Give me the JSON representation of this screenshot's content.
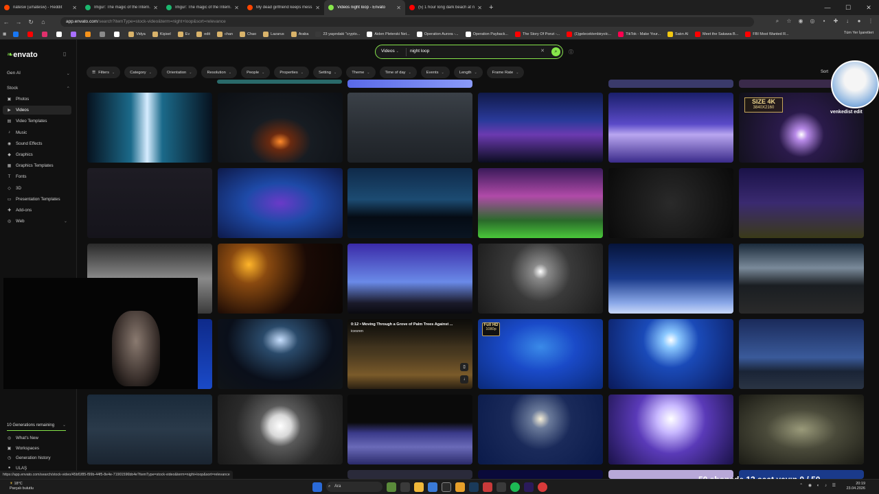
{
  "browser": {
    "tabs": [
      {
        "title": "natesw (u/natesw) - Reddit",
        "color": "#ff4500",
        "active": false
      },
      {
        "title": "Imgur: The magic of the Intern...",
        "color": "#1bb76e",
        "active": false
      },
      {
        "title": "Imgur: The magic of the Intern...",
        "color": "#1bb76e",
        "active": false
      },
      {
        "title": "My dead girlfriend keeps mess...",
        "color": "#ff4500",
        "active": false
      },
      {
        "title": "Videos night loop - Envato",
        "color": "#87e64b",
        "active": true
      },
      {
        "title": "(5) 1 hour long dark beach at n...",
        "color": "#ff0000",
        "active": false
      }
    ],
    "url_host": "app.envato.com",
    "url_path": "/search?itemType=stock-video&term=night+loop&sort=relevance",
    "bookmarks": [
      {
        "label": "",
        "color": "#1877f2"
      },
      {
        "label": "",
        "color": "#ff0000"
      },
      {
        "label": "",
        "color": "#e1306c"
      },
      {
        "label": "",
        "color": "#ffffff"
      },
      {
        "label": "",
        "color": "#a970ff"
      },
      {
        "label": "",
        "color": "#f7931a"
      },
      {
        "label": "",
        "color": "#8a8a8a"
      },
      {
        "label": "",
        "color": "#ffffff"
      },
      {
        "label": "Vidya",
        "color": "#d9b36a"
      },
      {
        "label": "Kişisel",
        "color": "#d9b36a"
      },
      {
        "label": "Ev",
        "color": "#d9b36a"
      },
      {
        "label": "edit",
        "color": "#d9b36a"
      },
      {
        "label": "chan",
        "color": "#d9b36a"
      },
      {
        "label": "Chao",
        "color": "#d9b36a"
      },
      {
        "label": "Lazarus",
        "color": "#d9b36a"
      },
      {
        "label": "Araba",
        "color": "#d9b36a"
      },
      {
        "label": "23 yaşındaki \"crypto...",
        "color": "#3a3a3a"
      },
      {
        "label": "Aiden Pleterski Net...",
        "color": "#ffffff"
      },
      {
        "label": "Operation Aurora -...",
        "color": "#ffffff"
      },
      {
        "label": "Operation Payback...",
        "color": "#ffffff"
      },
      {
        "label": "The Story Of Ponzi -...",
        "color": "#ff0000"
      },
      {
        "label": "(1)gelecektenbiryolc...",
        "color": "#ff0000"
      },
      {
        "label": "TikTok - Make Your...",
        "color": "#ff0050"
      },
      {
        "label": "Satın Al",
        "color": "#f2c811"
      },
      {
        "label": "Meet the Sakawa B...",
        "color": "#ff0000"
      },
      {
        "label": "FBI Most Wanted R...",
        "color": "#ff0000"
      }
    ],
    "bookmarks_right": "Tüm Yer İşaretleri"
  },
  "sidebar": {
    "logo": "envato",
    "gen_ai": "Gen AI",
    "stock": "Stock",
    "items": [
      {
        "label": "Photos",
        "icon": "photo-icon",
        "glyph": "▣",
        "selected": false
      },
      {
        "label": "Videos",
        "icon": "video-icon",
        "glyph": "▶",
        "selected": true
      },
      {
        "label": "Video Templates",
        "icon": "video-template-icon",
        "glyph": "▤",
        "selected": false
      },
      {
        "label": "Music",
        "icon": "music-icon",
        "glyph": "♪",
        "selected": false
      },
      {
        "label": "Sound Effects",
        "icon": "sound-icon",
        "glyph": "◉",
        "selected": false
      },
      {
        "label": "Graphics",
        "icon": "graphics-icon",
        "glyph": "◆",
        "selected": false
      },
      {
        "label": "Graphics Templates",
        "icon": "graphics-template-icon",
        "glyph": "▦",
        "selected": false
      },
      {
        "label": "Fonts",
        "icon": "font-icon",
        "glyph": "T",
        "selected": false
      },
      {
        "label": "3D",
        "icon": "cube-icon",
        "glyph": "◇",
        "selected": false
      },
      {
        "label": "Presentation Templates",
        "icon": "presentation-icon",
        "glyph": "▭",
        "selected": false
      },
      {
        "label": "Add-ons",
        "icon": "addon-icon",
        "glyph": "✚",
        "selected": false
      },
      {
        "label": "Web",
        "icon": "web-icon",
        "glyph": "◎",
        "selected": false
      }
    ],
    "generations": "10 Generations remaining",
    "bottom": [
      {
        "label": "What's New",
        "icon": "bell-icon",
        "glyph": "◎"
      },
      {
        "label": "Workspaces",
        "icon": "folder-icon",
        "glyph": "▣"
      },
      {
        "label": "Generation history",
        "icon": "history-icon",
        "glyph": "◷"
      },
      {
        "label": "ULAŞ",
        "icon": "user-icon",
        "glyph": "●"
      }
    ]
  },
  "search": {
    "type": "Videos",
    "term": "night loop"
  },
  "filters": [
    "Filters",
    "Category",
    "Orientation",
    "Resolution",
    "People",
    "Properties",
    "Setting",
    "Theme",
    "Time of day",
    "Events",
    "Length",
    "Frame Rate"
  ],
  "sort_label": "Sort",
  "hover_card": {
    "title": "0:12 • Moving Through a Grove of Palm Trees Against ...",
    "author": "icesren"
  },
  "badges": {
    "size4k": "SIZE 4K",
    "size4k_res": "3840X2160",
    "fullhd": "Full HD",
    "fullhd_res": "1080p"
  },
  "avatar_label": "venkedist edit",
  "status_url": "https://app.envato.com/search/stock-video/45bf1f85-f99b-44f5-8e4e-71901596bb4e?itemType=stock-video&term=night+loop&sort=relevance",
  "stream_overlay": "50 abonede 12 saat yayın 0 / 50",
  "taskbar": {
    "temp": "18°C",
    "weather": "Parçalı bulutlu",
    "search": "Ara",
    "time": "20:19",
    "date": "23.04.2026"
  },
  "thumbs": [
    {
      "row": 0,
      "col": 0,
      "bg": "linear-gradient(90deg,#07121f 0%,#1b6a8a 35%,#d6ecff 48%,#1b6a8a 60%,#07121f 100%)"
    },
    {
      "row": 0,
      "col": 1,
      "bg": "radial-gradient(ellipse at 50% 70%,#ff8a2a 0%,#6a2a10 12%,#171c22 35%,#0c0f14 100%)"
    },
    {
      "row": 0,
      "col": 2,
      "bg": "linear-gradient(180deg,#3b4148 0%,#2a2f35 50%,#1e2227 100%)"
    },
    {
      "row": 0,
      "col": 3,
      "bg": "linear-gradient(180deg,#101a4a 0%,#2a3a9a 40%,#6b3ab0 60%,#0b0d20 100%)"
    },
    {
      "row": 0,
      "col": 4,
      "bg": "linear-gradient(180deg,#1a1f6a 0%,#5a4ac8 45%,#b9a6f0 60%,#3a2a8a 100%)"
    },
    {
      "row": 0,
      "col": 5,
      "bg": "radial-gradient(circle at 50% 60%,#ffffff 0%,#b88ae8 8%,#2a1a4a 30%,#101018 100%)"
    },
    {
      "row": 1,
      "col": 0,
      "bg": "linear-gradient(180deg,#1e1c24 0%,#15141b 100%)"
    },
    {
      "row": 1,
      "col": 1,
      "bg": "radial-gradient(ellipse at 50% 50%,#6a3ac8 0%,#1e4aa8 40%,#0e1a4a 100%)"
    },
    {
      "row": 1,
      "col": 2,
      "bg": "linear-gradient(180deg,#0f2a4a 0%,#1c4b72 45%,#050b14 70%,#0a1522 100%)"
    },
    {
      "row": 1,
      "col": 3,
      "bg": "linear-gradient(180deg,#3a1a5a 0%,#b04aa8 40%,#2a6a2a 75%,#4ac83a 100%)"
    },
    {
      "row": 1,
      "col": 4,
      "bg": "radial-gradient(circle at 50% 50%,#2a2a2a 0%,#0a0a0a 100%)"
    },
    {
      "row": 1,
      "col": 5,
      "bg": "linear-gradient(180deg,#1a1248 0%,#3a2a70 50%,#3a3a18 100%)"
    },
    {
      "row": 2,
      "col": 0,
      "bg": "linear-gradient(180deg,#2a2a2a 0%,#8a8a8a 50%,#3a3a3a 100%)"
    },
    {
      "row": 2,
      "col": 1,
      "bg": "radial-gradient(circle at 25% 30%,#ffb52a 0%,#8a4a10 18%,#1a0a05 55%,#0a0503 100%)"
    },
    {
      "row": 2,
      "col": 2,
      "bg": "linear-gradient(180deg,#3a2aa8 0%,#6a8ae8 55%,#1a1a2a 85%,#0a0a10 100%)"
    },
    {
      "row": 2,
      "col": 3,
      "bg": "radial-gradient(circle at 50% 40%,#ffffff 0%,#8a8a8a 10%,#3a3a3a 40%,#1a1a1a 100%)"
    },
    {
      "row": 2,
      "col": 4,
      "bg": "linear-gradient(180deg,#06143a 0%,#1a3a8a 50%,#8aa8e8 85%,#c8d8f8 100%)"
    },
    {
      "row": 2,
      "col": 5,
      "bg": "linear-gradient(180deg,#1a2a3a 0%,#7a8a9a 35%,#1a1e22 60%,#2a2a2a 100%)"
    },
    {
      "row": 3,
      "col": 0,
      "bg": "linear-gradient(180deg,#0e2a8a 0%,#1a4ac8 100%)"
    },
    {
      "row": 3,
      "col": 1,
      "bg": "radial-gradient(ellipse at 50% 30%,#c8e0ff 0%,#2a4a6a 20%,#0a0f1a 60%,#101418 100%)"
    },
    {
      "row": 3,
      "col": 2,
      "bg": "linear-gradient(180deg,#1c1a14 0%,#4a3a20 50%,#7a5a2a 80%,#2a2012 100%)"
    },
    {
      "row": 3,
      "col": 3,
      "bg": "radial-gradient(ellipse at 50% 40%,#3a8ae8 0%,#1a4ac8 40%,#0a2a7a 100%)"
    },
    {
      "row": 3,
      "col": 4,
      "bg": "radial-gradient(circle at 50% 30%,#ffffff 0%,#8ac8ff 10%,#1a4ab8 35%,#0a1a5a 100%)"
    },
    {
      "row": 3,
      "col": 5,
      "bg": "linear-gradient(180deg,#1a2a5a 0%,#3a5a9a 55%,#1a2436 75%,#2a3444 100%)"
    },
    {
      "row": 4,
      "col": 0,
      "bg": "linear-gradient(180deg,#1a2a3a 0%,#2a3a4a 50%,#1a2430 100%)"
    },
    {
      "row": 4,
      "col": 1,
      "bg": "radial-gradient(circle at 50% 45%,#ffffff 0%,#d8d8d8 15%,#5a5a5a 28%,#2a2a2a 60%,#1a1a1a 100%)"
    },
    {
      "row": 4,
      "col": 2,
      "bg": "linear-gradient(180deg,#0a0a0a 0%,#0a0a0a 40%,#3a3a8a 55%,#6a6ab8 75%,#2a2a6a 100%)"
    },
    {
      "row": 4,
      "col": 3,
      "bg": "radial-gradient(circle at 50% 35%,#f8f0d8 0%,#6a7a9a 12%,#1a2a5a 40%,#0a1a4a 100%)"
    },
    {
      "row": 4,
      "col": 4,
      "bg": "radial-gradient(circle at 50% 35%,#ffffff 0%,#c8b8ff 18%,#5a3ab8 45%,#1a1248 100%)"
    },
    {
      "row": 4,
      "col": 5,
      "bg": "radial-gradient(ellipse at 50% 50%,#9a9a7a 0%,#4a4a3a 40%,#1a1a14 100%)"
    }
  ]
}
